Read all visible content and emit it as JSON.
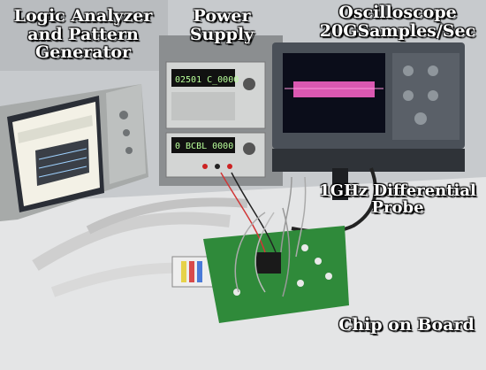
{
  "labels": {
    "logic_analyzer_line1": "Logic Analyzer",
    "logic_analyzer_line2": "and Pattern",
    "logic_analyzer_line3": "Generator",
    "power_supply_line1": "Power",
    "power_supply_line2": "Supply",
    "oscilloscope_line1": "Oscilloscope",
    "oscilloscope_line2": "20GSamples/Sec",
    "probe_line1": "1GHz Differential",
    "probe_line2": "Probe",
    "chip_on_board": "Chip on Board"
  },
  "displays": {
    "psu_top_readout": "02501 C_0000",
    "psu_bottom_readout": "0 BCBL 0000"
  },
  "colors": {
    "scope_waveform": "#ff66cc",
    "pcb_green": "#2f8a3a",
    "la_screen": "#f3f1e6",
    "wall": "#c9ccd0"
  }
}
